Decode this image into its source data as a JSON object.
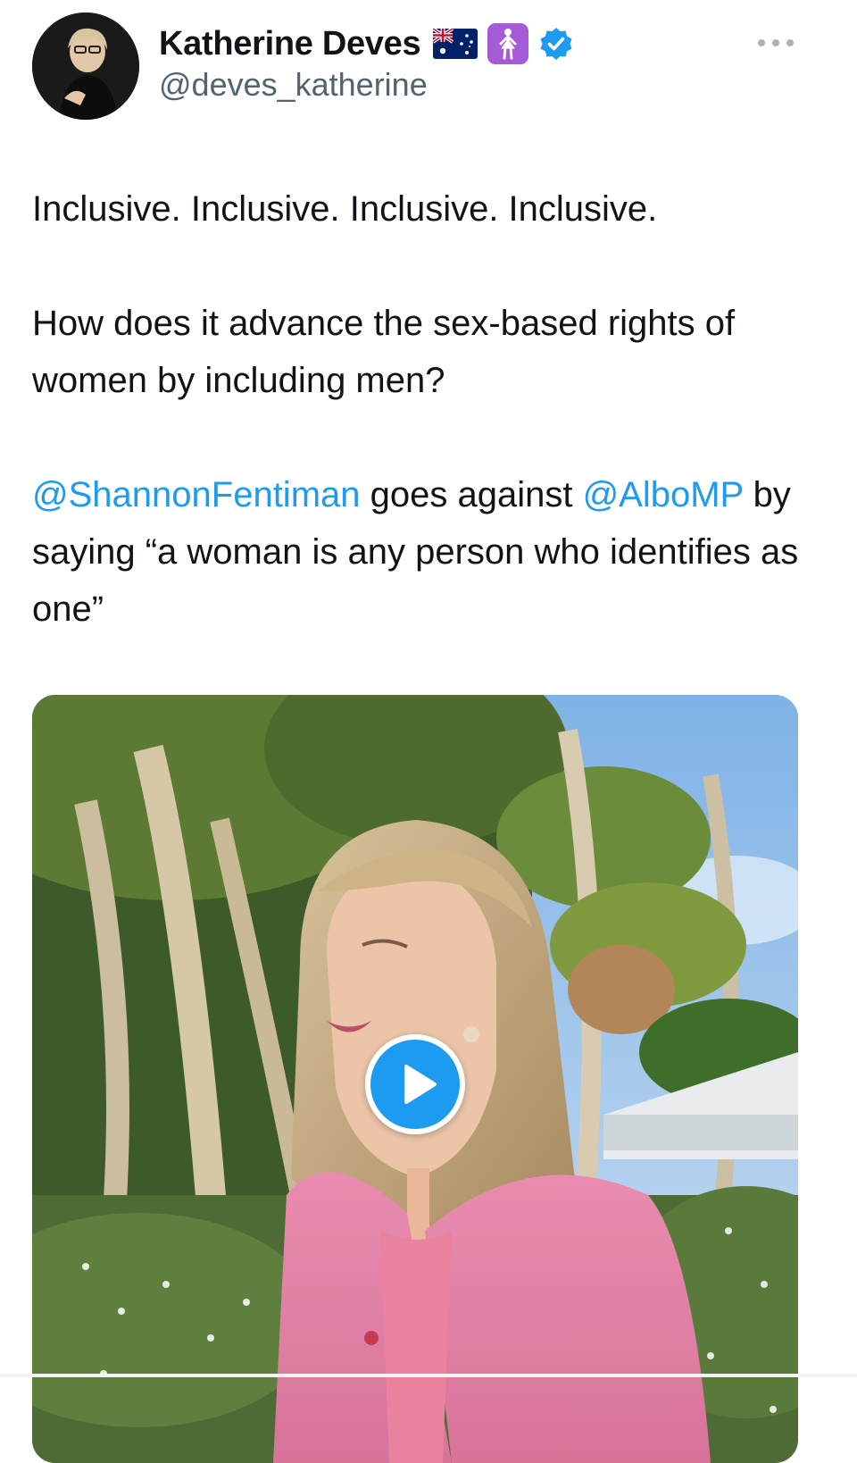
{
  "author": {
    "display_name": "Katherine Deves",
    "handle": "@deves_katherine",
    "badges": [
      "australia-flag-icon",
      "standing-woman-emoji-icon",
      "verified-icon"
    ],
    "verified_color": "#1d9bf0"
  },
  "menu": {
    "icon": "more-options-icon"
  },
  "tweet": {
    "paragraph1": "Inclusive. Inclusive. Inclusive. Inclusive.",
    "paragraph2": "How does it advance the sex-based rights of women by including men?",
    "mention1": "@ShannonFentiman",
    "text_a": " goes against ",
    "mention2": "@AlboMP",
    "text_b": " by saying “a woman is any person who identifies as one”",
    "mention_color": "#1d9bf0"
  },
  "media": {
    "type": "video",
    "play_icon": "play-icon"
  }
}
